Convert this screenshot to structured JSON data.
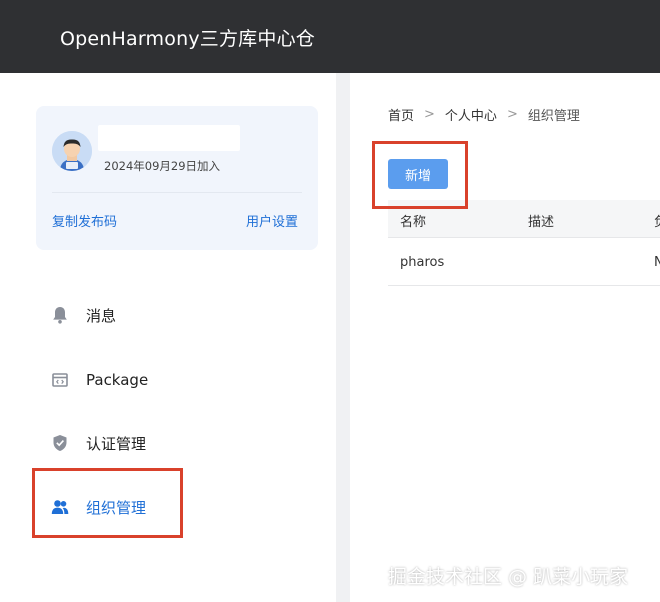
{
  "header": {
    "title": "OpenHarmony三方库中心仓"
  },
  "profile": {
    "join_date": "2024年09月29日加入",
    "copy_code_link": "复制发布码",
    "user_settings_link": "用户设置"
  },
  "sidebar": {
    "items": [
      {
        "label": "消息",
        "icon": "bell-icon"
      },
      {
        "label": "Package",
        "icon": "package-icon"
      },
      {
        "label": "认证管理",
        "icon": "shield-icon"
      },
      {
        "label": "组织管理",
        "icon": "users-icon",
        "active": true
      }
    ]
  },
  "breadcrumb": {
    "items": [
      "首页",
      "个人中心",
      "组织管理"
    ],
    "separator": ">"
  },
  "toolbar": {
    "add_label": "新增"
  },
  "table": {
    "columns": [
      "名称",
      "描述",
      "负"
    ],
    "rows": [
      {
        "name": "pharos",
        "description": "",
        "third": "N"
      }
    ]
  },
  "watermark": {
    "text": "掘金技术社区 @ 趴菜小玩家"
  },
  "colors": {
    "accent": "#1f6fd6",
    "button": "#5b9dee",
    "highlight": "#d9412b",
    "header": "#2f3033"
  }
}
